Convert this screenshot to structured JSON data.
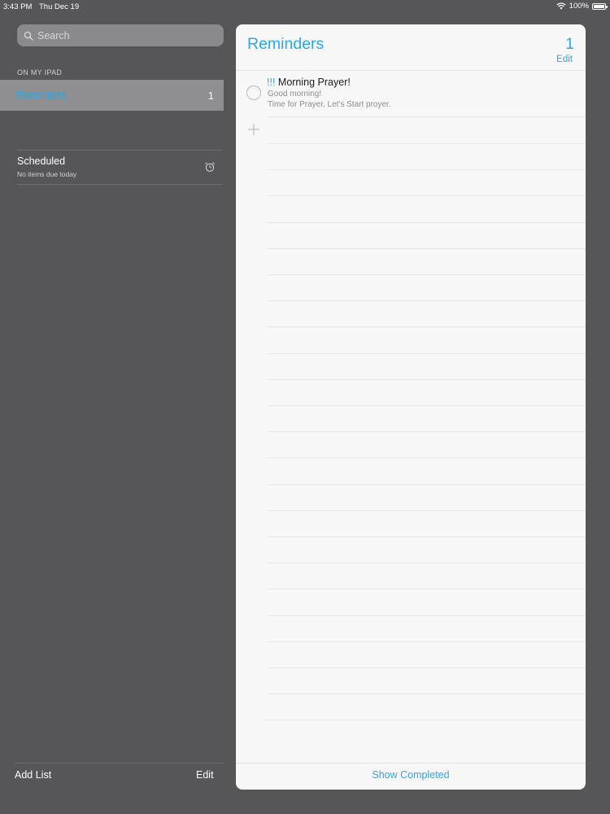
{
  "status_bar": {
    "time": "3:43 PM",
    "date": "Thu Dec 19",
    "battery_percent": "100%",
    "battery_level": 1.0
  },
  "sidebar": {
    "search_placeholder": "Search",
    "section_header": "ON MY IPAD",
    "lists": [
      {
        "label": "Reminders",
        "count": "1",
        "selected": true
      }
    ],
    "scheduled": {
      "title": "Scheduled",
      "subtitle": "No items due today"
    },
    "add_list_label": "Add List",
    "edit_label": "Edit"
  },
  "panel": {
    "title": "Reminders",
    "count": "1",
    "edit_label": "Edit",
    "reminders": [
      {
        "priority": "!!!",
        "title": "Morning Prayer!",
        "note_line1": "Good morning!",
        "note_line2": "Time for Prayer, Let's Start proyer."
      }
    ],
    "show_completed_label": "Show Completed"
  },
  "colors": {
    "accent": "#2ba8e4",
    "sidebar_bg": "#565558",
    "selected_row_bg": "#8f8e91",
    "panel_bg": "#f7f7f8"
  }
}
